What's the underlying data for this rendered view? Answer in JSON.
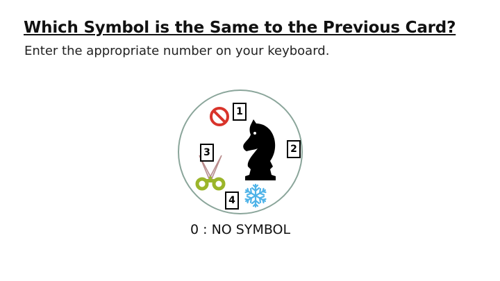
{
  "page": {
    "title": "Which Symbol is the Same to the Previous Card?",
    "instruction": "Enter the appropriate number on your keyboard."
  },
  "card": {
    "symbols": [
      {
        "number": "1",
        "icon": "no-entry-icon",
        "color": "#d9342b"
      },
      {
        "number": "2",
        "icon": "chess-knight-icon",
        "color": "#000000"
      },
      {
        "number": "3",
        "icon": "scissors-icon",
        "color": "#9bb52a"
      },
      {
        "number": "4",
        "icon": "snowflake-icon",
        "color": "#4fb3e8"
      }
    ],
    "border_color": "#8aa59a"
  },
  "no_symbol_option": "0 : NO SYMBOL"
}
